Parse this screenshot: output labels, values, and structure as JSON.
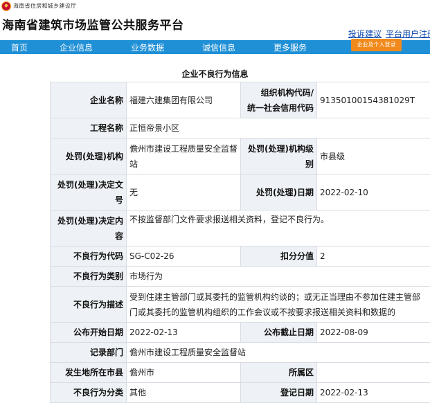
{
  "header": {
    "department": "海南省住房和城乡建设厅",
    "site_title": "海南省建筑市场监管公共服务平台",
    "links": [
      "投诉建议",
      "平台用户注册"
    ]
  },
  "nav": {
    "items": [
      "首页",
      "企业信息",
      "业务数据",
      "诚信信息",
      "更多服务"
    ],
    "login_button": "企业及个人登录"
  },
  "page": {
    "section_title": "企业不良行为信息"
  },
  "fields": {
    "company_name_label": "企业名称",
    "company_name": "福建六建集团有限公司",
    "org_code_label_1": "组织机构代码/",
    "org_code_label_2": "统一社会信用代码",
    "org_code": "91350100154381029T",
    "project_name_label": "工程名称",
    "project_name": "正恒帝景小区",
    "agency_label": "处罚(处理)机构",
    "agency": "儋州市建设工程质量安全监督站",
    "agency_level_label": "处罚(处理)机构级别",
    "agency_level": "市县级",
    "decision_doc_label": "处罚(处理)决定文号",
    "decision_doc": "无",
    "decision_date_label": "处罚(处理)日期",
    "decision_date": "2022-02-10",
    "decision_content_label": "处罚(处理)决定内容",
    "decision_content": "不按监督部门文件要求报送相关资料，登记不良行为。",
    "behavior_code_label": "不良行为代码",
    "behavior_code": "SG-C02-26",
    "score_label": "扣分分值",
    "score": "2",
    "behavior_type_label": "不良行为类别",
    "behavior_type": "市场行为",
    "behavior_desc_label": "不良行为描述",
    "behavior_desc": "受到住建主管部门或其委托的监管机构约谈的；或无正当理由不参加住建主管部门或其委托的监管机构组织的工作会议或不按要求报送相关资料和数据的",
    "publish_start_label": "公布开始日期",
    "publish_start": "2022-02-13",
    "publish_end_label": "公布截止日期",
    "publish_end": "2022-08-09",
    "record_dept_label": "记录部门",
    "record_dept": "儋州市建设工程质量安全监督站",
    "city_label": "发生地所在市县",
    "city": "儋州市",
    "district_label": "所属区",
    "district": "",
    "category_label": "不良行为分类",
    "category": "其他",
    "register_date_label": "登记日期",
    "register_date": "2022-02-13"
  }
}
